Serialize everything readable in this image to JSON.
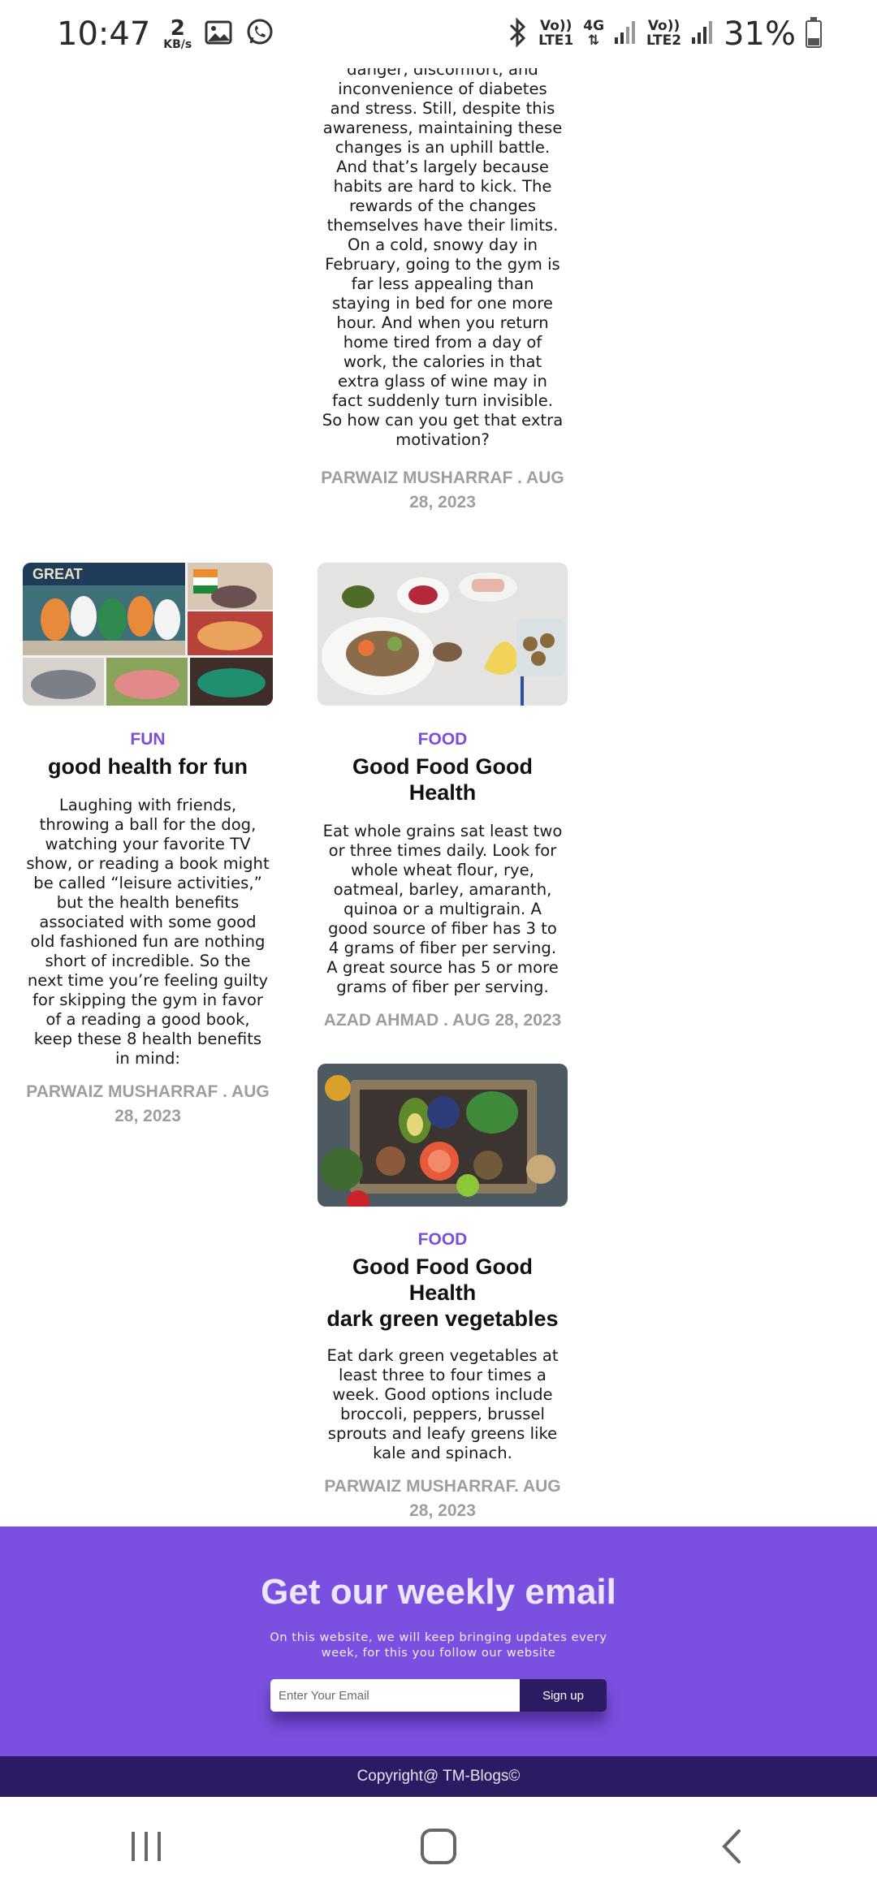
{
  "status_bar": {
    "time": "10:47",
    "speed_value": "2",
    "speed_unit": "KB/s",
    "sim1_label_top": "Vo))",
    "sim1_label_bottom": "LTE1",
    "net_type": "4G",
    "sim2_label_top": "Vo))",
    "sim2_label_bottom": "LTE2",
    "battery_percent": "31%",
    "battery_level": 0.31,
    "icons": [
      "gallery-icon",
      "whatsapp-icon",
      "bluetooth-icon",
      "signal-icon"
    ]
  },
  "posts": [
    {
      "text": [
        "danger, discomfort, and",
        "inconvenience of diabetes",
        "and stress. Still, despite this",
        "awareness, maintaining these",
        "changes is an uphill battle.",
        "And that’s largely because",
        "habits are hard to kick. The",
        "rewards of the changes",
        "themselves have their limits.",
        "On a cold, snowy day in",
        "February, going to the gym is",
        "far less appealing than",
        "staying in bed for one more",
        "hour. And when you return",
        "home tired from a day of",
        "work, the calories in that",
        "extra glass of wine may in",
        "fact suddenly turn invisible.",
        "So how can you get that extra",
        "motivation?"
      ],
      "meta": [
        "PARWAIZ MUSHARRAF . AUG",
        "28, 2023"
      ]
    },
    {
      "image": "group-photo-collage",
      "category": "FUN",
      "title": [
        "good health for fun"
      ],
      "text": [
        "Laughing with friends,",
        "throwing a ball for the dog,",
        "watching your favorite TV",
        "show, or reading a book might",
        "be called “leisure activities,”",
        "but the health benefits",
        "associated with some good",
        "old fashioned fun are nothing",
        "short of incredible. So the",
        "next time you’re feeling guilty",
        "for skipping the gym in favor",
        "of a reading a good book,",
        "keep these 8 health benefits",
        "in mind:"
      ],
      "meta": [
        "PARWAIZ MUSHARRAF . AUG",
        "28, 2023"
      ]
    },
    {
      "image": "food-plates-photo",
      "category": "FOOD",
      "title": [
        "Good Food Good Health"
      ],
      "text": [
        "Eat whole grains sat least two",
        "or three times daily. Look for",
        "whole wheat flour, rye,",
        "oatmeal, barley, amaranth,",
        "quinoa or a multigrain. A",
        "good source of fiber has 3 to",
        "4 grams of fiber per serving.",
        "A great source has 5 or more",
        "grams of fiber per serving."
      ],
      "meta": [
        "AZAD AHMAD . AUG 28, 2023"
      ]
    },
    {
      "image": "vegetables-crate-photo",
      "category": "FOOD",
      "title": [
        "Good Food Good Health",
        "dark green vegetables"
      ],
      "text": [
        "Eat dark green vegetables at",
        "least three to four times a",
        "week. Good options include",
        "broccoli, peppers, brussel",
        "sprouts and leafy greens like",
        "kale and spinach."
      ],
      "meta": [
        "PARWAIZ MUSHARRAF. AUG",
        "28, 2023"
      ]
    }
  ],
  "newsletter": {
    "title": "Get our weekly email",
    "description_line1": "On this website, we will keep bringing updates every",
    "description_line2": "week, for this you follow our website",
    "email_placeholder": "Enter Your Email",
    "email_value": "",
    "signup_label": "Sign up"
  },
  "footer": {
    "copyright": "Copyright@ TM-Blogs©"
  },
  "nav": {
    "icons": [
      "recent-apps-icon",
      "home-icon",
      "back-icon"
    ]
  },
  "colors": {
    "accent": "#7b50e0",
    "dark_accent": "#2c1a63",
    "category": "#7b4fd8",
    "meta": "#9e9e9e"
  }
}
